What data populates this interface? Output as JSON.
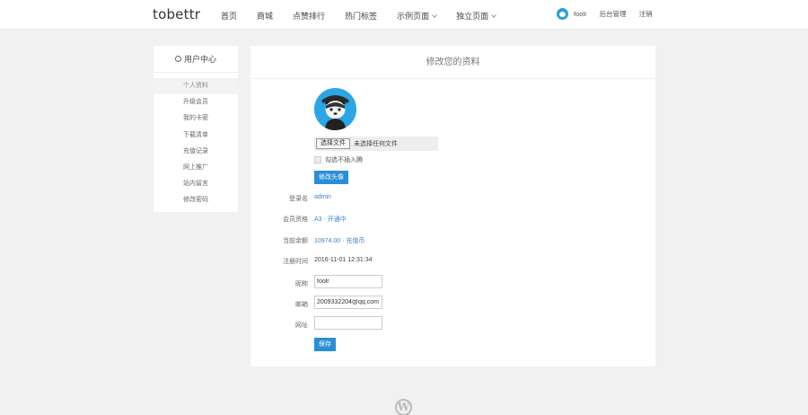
{
  "header": {
    "logo": "tobettr",
    "nav": [
      {
        "label": "首页",
        "has_dropdown": false
      },
      {
        "label": "商城",
        "has_dropdown": false
      },
      {
        "label": "点赞排行",
        "has_dropdown": false
      },
      {
        "label": "热门标签",
        "has_dropdown": false
      },
      {
        "label": "示例页面",
        "has_dropdown": true
      },
      {
        "label": "独立页面",
        "has_dropdown": true
      }
    ],
    "user_name": "foolr",
    "link_admin": "后台管理",
    "link_logout": "注销"
  },
  "sidebar": {
    "title": "用户中心",
    "items": [
      {
        "label": "个人资料",
        "active": true
      },
      {
        "label": "升级会员",
        "active": false
      },
      {
        "label": "我的卡密",
        "active": false
      },
      {
        "label": "下载清单",
        "active": false
      },
      {
        "label": "充值记录",
        "active": false
      },
      {
        "label": "网上推广",
        "active": false
      },
      {
        "label": "站内留言",
        "active": false
      },
      {
        "label": "修改密码",
        "active": false
      }
    ]
  },
  "main": {
    "title": "修改您的资料",
    "file_button": "选择文件",
    "file_status": "未选择任何文件",
    "checkbox_label": "勾选不插入腾",
    "avatar_button": "修改头像",
    "fields": [
      {
        "label": "登录名",
        "value": "admin",
        "link": true
      },
      {
        "label": "会员资格",
        "value": "A3 · 开通中",
        "link": true
      },
      {
        "label": "当前余额",
        "value": "10974.00 · 充值币",
        "link": true
      },
      {
        "label": "注册时间",
        "value": "2016-11-01 12:31:34",
        "link": false
      }
    ],
    "inputs": [
      {
        "label": "昵称",
        "value": "foolr",
        "placeholder": ""
      },
      {
        "label": "邮箱",
        "value": "2009332204@qq.com",
        "placeholder": ""
      },
      {
        "label": "网址",
        "value": "",
        "placeholder": ""
      }
    ],
    "save_button": "保存"
  },
  "footer": {
    "logo_glyph": "W"
  },
  "colors": {
    "accent": "#2a8ed6",
    "avatar_bg": "#2aa6e4",
    "link": "#3b83c4",
    "page_bg": "#f1f1f1"
  }
}
